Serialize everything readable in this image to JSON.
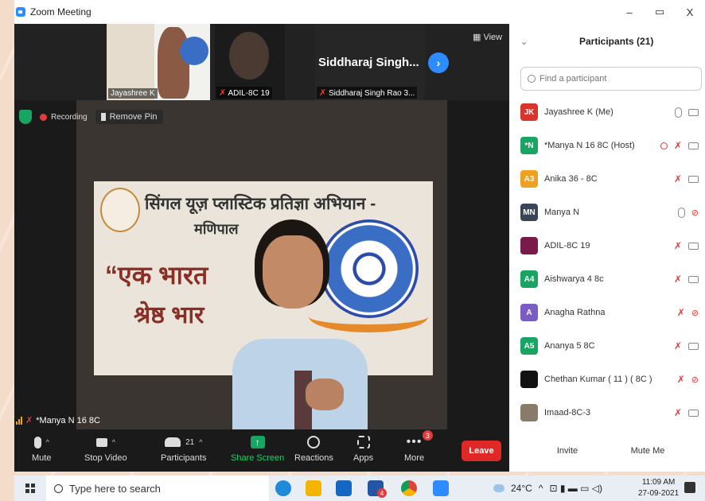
{
  "window": {
    "title": "Zoom Meeting",
    "minimize": "–",
    "restore": "▭",
    "close": "X"
  },
  "video_strip": {
    "thumbnails": [
      {
        "name": "Jayashree K"
      },
      {
        "name": "ADIL-8C 19"
      },
      {
        "name": "Siddharaj Singh Rao 3...",
        "display": "Siddharaj  Singh..."
      }
    ],
    "next_label": "›",
    "view_label": "View"
  },
  "main_video": {
    "recording_label": "Recording",
    "remove_pin_label": "Remove Pin",
    "speaker_name": "*Manya N 16 8C",
    "banner": {
      "line1": "सिंगल यूज़ प्लास्टिक प्रतिज्ञा अभियान -",
      "line2": "मणिपाल",
      "line3": "“एक भारत",
      "line4": "श्रेष्ठ भार"
    }
  },
  "toolbar": {
    "mute": "Mute",
    "stop_video": "Stop Video",
    "participants": "Participants",
    "participants_count": "21",
    "share_screen": "Share Screen",
    "reactions": "Reactions",
    "apps": "Apps",
    "more": "More",
    "more_badge": "3",
    "leave": "Leave"
  },
  "panel": {
    "title": "Participants (21)",
    "search_placeholder": "Find a participant",
    "participants": [
      {
        "initials": "JK",
        "name": "Jayashree K (Me)",
        "color": "#d9342b",
        "mic": "on",
        "cam": "on"
      },
      {
        "initials": "*N",
        "name": "*Manya N 16 8C (Host)",
        "color": "#19a463",
        "mic": "off",
        "cam": "on",
        "recording": true
      },
      {
        "initials": "A3",
        "name": "Anika 36 - 8C",
        "color": "#f0a020",
        "mic": "off",
        "cam": "on"
      },
      {
        "initials": "MN",
        "name": "Manya N",
        "color": "#3a4656",
        "mic": "on",
        "cam": "off"
      },
      {
        "initials": "",
        "name": "ADIL-8C 19",
        "color": "#7a1a4a",
        "mic": "off",
        "cam": "on"
      },
      {
        "initials": "A4",
        "name": "Aishwarya 4 8c",
        "color": "#19a463",
        "mic": "off",
        "cam": "on"
      },
      {
        "initials": "A",
        "name": "Anagha Rathna",
        "color": "#7b5cc4",
        "mic": "off",
        "cam": "off"
      },
      {
        "initials": "A5",
        "name": "Ananya 5 8C",
        "color": "#19a463",
        "mic": "off",
        "cam": "on"
      },
      {
        "initials": "",
        "name": "Chethan Kumar ( 11 ) ( 8C )",
        "color": "#111111",
        "mic": "off",
        "cam": "off"
      },
      {
        "initials": "",
        "name": "Imaad-8C-3",
        "color": "#8a7a6a",
        "mic": "off",
        "cam": "on"
      }
    ],
    "invite": "Invite",
    "mute_me": "Mute Me"
  },
  "taskbar": {
    "search_placeholder": "Type here to search",
    "app_badge": "4",
    "temperature": "24°C",
    "time": "11:09 AM",
    "date": "27-09-2021",
    "notif_count": "1"
  }
}
